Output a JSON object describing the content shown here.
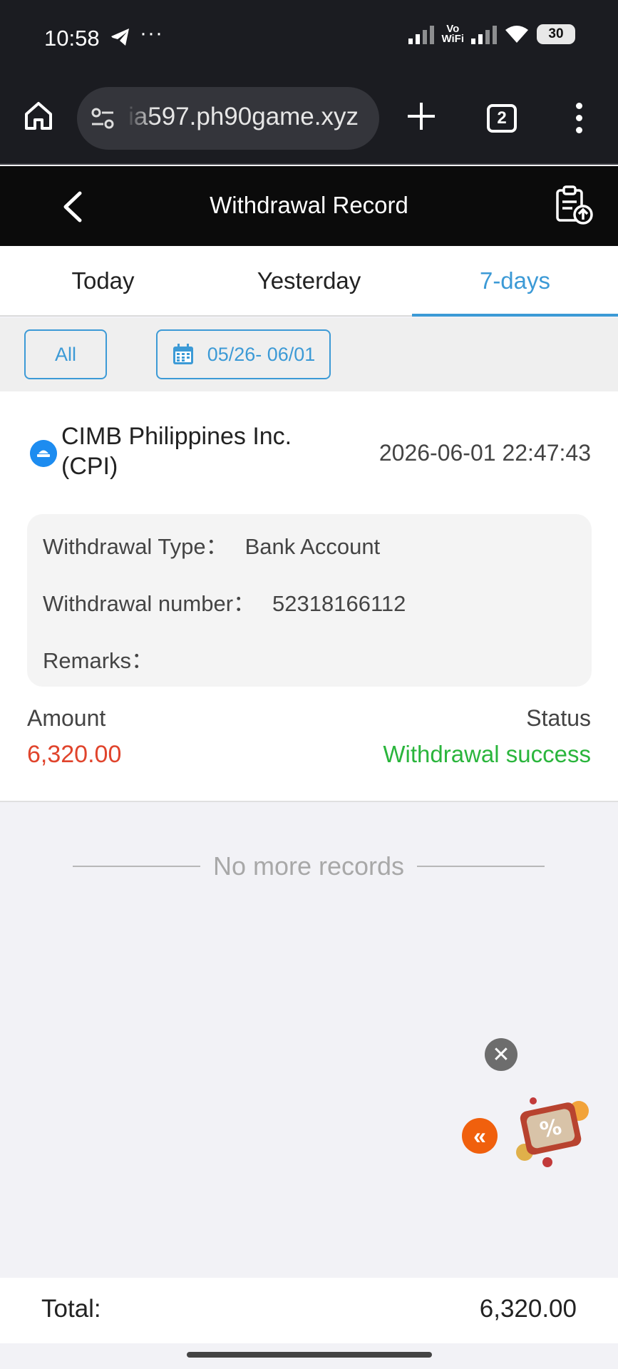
{
  "status_bar": {
    "time": "10:58",
    "more": "···",
    "vowifi_top": "Vo",
    "vowifi_bottom": "WiFi",
    "battery": "30"
  },
  "browser": {
    "url": "ia597.ph90game.xyz",
    "tab_count": "2"
  },
  "header": {
    "title": "Withdrawal Record"
  },
  "tabs": [
    {
      "label": "Today",
      "active": false
    },
    {
      "label": "Yesterday",
      "active": false
    },
    {
      "label": "7-days",
      "active": true
    }
  ],
  "filters": {
    "all_label": "All",
    "date_range": "05/26- 06/01"
  },
  "record": {
    "bank_name": "CIMB Philippines Inc. (CPI)",
    "datetime": "2026-06-01 22:47:43",
    "withdrawal_type_label": "Withdrawal Type：",
    "withdrawal_type_value": "Bank Account",
    "withdrawal_number_label": "Withdrawal number：",
    "withdrawal_number_value": "52318166112",
    "remarks_label": "Remarks：",
    "remarks_value": "",
    "amount_label": "Amount",
    "amount_value": "6,320.00",
    "status_label": "Status",
    "status_value": "Withdrawal success"
  },
  "list_end_text": "No more records",
  "total": {
    "label": "Total:",
    "value": "6,320.00"
  },
  "colors": {
    "accent": "#3c9ad6",
    "amount": "#e0442c",
    "success": "#2ab53c",
    "header_bg": "#0b0b0b",
    "browser_bg": "#1b1c21"
  }
}
